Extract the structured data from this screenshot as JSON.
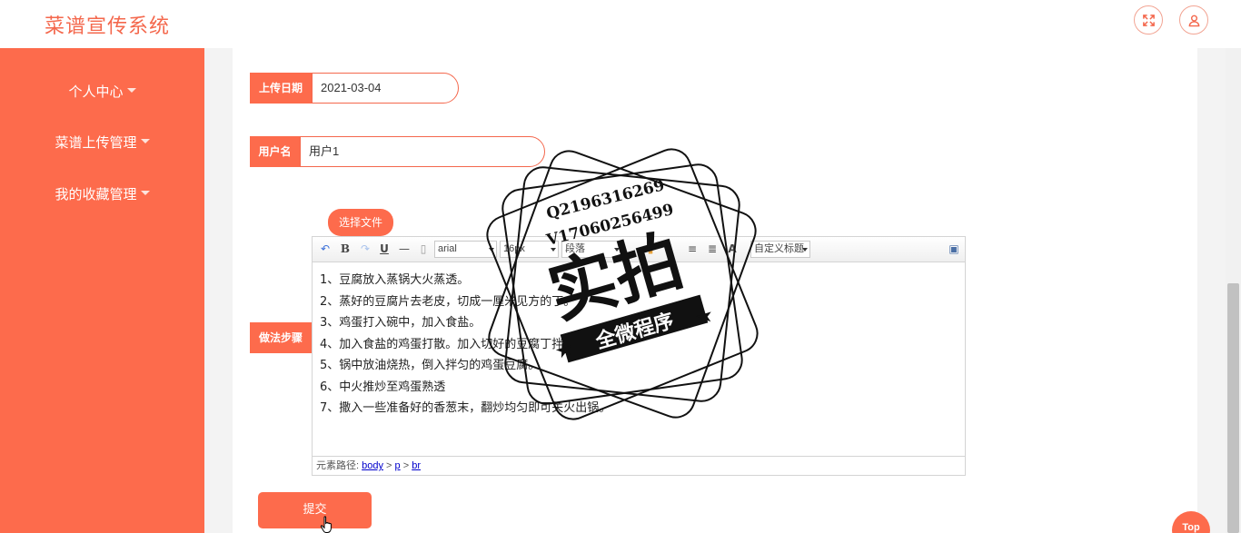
{
  "app": {
    "title": "菜谱宣传系统"
  },
  "header": {
    "fullscreen_icon": "fullscreen-icon",
    "user_icon": "user-icon"
  },
  "sidebar": {
    "items": [
      {
        "label": "个人中心"
      },
      {
        "label": "菜谱上传管理"
      },
      {
        "label": "我的收藏管理"
      }
    ]
  },
  "form": {
    "upload_date": {
      "label": "上传日期",
      "value": "2021-03-04"
    },
    "username": {
      "label": "用户名",
      "value": "用户1"
    },
    "file_button": "选择文件",
    "steps": {
      "label": "做法步骤",
      "toolbar": {
        "font_family": "arial",
        "font_size": "16px",
        "paragraph": "段落",
        "custom_title": "自定义标题"
      },
      "lines": [
        "1、豆腐放入蒸锅大火蒸透。",
        "2、蒸好的豆腐片去老皮，切成一厘米见方的丁。",
        "3、鸡蛋打入碗中，加入食盐。",
        "4、加入食盐的鸡蛋打散。加入切好的豆腐丁拌匀。",
        "5、锅中放油烧热，倒入拌匀的鸡蛋豆腐。",
        "6、中火推炒至鸡蛋熟透",
        "7、撒入一些准备好的香葱末，翻炒均匀即可关火出锅。"
      ],
      "path": {
        "prefix": "元素路径:",
        "p1": "body",
        "p2": "p",
        "p3": "br"
      }
    },
    "submit": "提交"
  },
  "top_button": "Top",
  "stamp": {
    "line1": "Q2196316269",
    "line2": "V17060256499",
    "main": "实拍",
    "sub": "全微程序"
  },
  "colors": {
    "accent": "#fd6b4c",
    "sidebar": "#fd6b4c",
    "title": "#f4684d"
  }
}
